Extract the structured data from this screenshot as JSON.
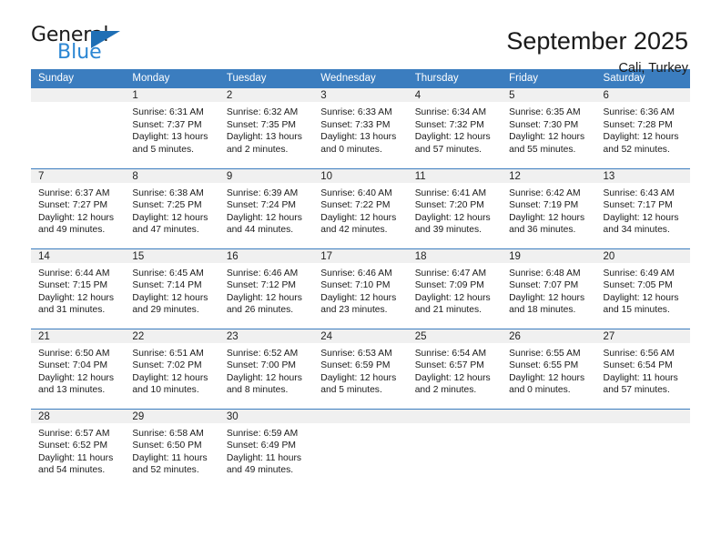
{
  "brand": {
    "name_top": "General",
    "name_bottom": "Blue",
    "triangle_color": "#1f6fb5",
    "blue_color": "#2b86d3"
  },
  "header": {
    "title": "September 2025",
    "subtitle": "Cali, Turkey"
  },
  "theme": {
    "header_row_bg": "#3b7dbf",
    "daynum_band_bg": "#f0f0f0",
    "grid_line": "#3b7dbf",
    "text": "#1a1a1a"
  },
  "weekday_headers": [
    "Sunday",
    "Monday",
    "Tuesday",
    "Wednesday",
    "Thursday",
    "Friday",
    "Saturday"
  ],
  "weeks": [
    [
      {
        "day": "",
        "lines": []
      },
      {
        "day": "1",
        "lines": [
          "Sunrise: 6:31 AM",
          "Sunset: 7:37 PM",
          "Daylight: 13 hours",
          "and 5 minutes."
        ]
      },
      {
        "day": "2",
        "lines": [
          "Sunrise: 6:32 AM",
          "Sunset: 7:35 PM",
          "Daylight: 13 hours",
          "and 2 minutes."
        ]
      },
      {
        "day": "3",
        "lines": [
          "Sunrise: 6:33 AM",
          "Sunset: 7:33 PM",
          "Daylight: 13 hours",
          "and 0 minutes."
        ]
      },
      {
        "day": "4",
        "lines": [
          "Sunrise: 6:34 AM",
          "Sunset: 7:32 PM",
          "Daylight: 12 hours",
          "and 57 minutes."
        ]
      },
      {
        "day": "5",
        "lines": [
          "Sunrise: 6:35 AM",
          "Sunset: 7:30 PM",
          "Daylight: 12 hours",
          "and 55 minutes."
        ]
      },
      {
        "day": "6",
        "lines": [
          "Sunrise: 6:36 AM",
          "Sunset: 7:28 PM",
          "Daylight: 12 hours",
          "and 52 minutes."
        ]
      }
    ],
    [
      {
        "day": "7",
        "lines": [
          "Sunrise: 6:37 AM",
          "Sunset: 7:27 PM",
          "Daylight: 12 hours",
          "and 49 minutes."
        ]
      },
      {
        "day": "8",
        "lines": [
          "Sunrise: 6:38 AM",
          "Sunset: 7:25 PM",
          "Daylight: 12 hours",
          "and 47 minutes."
        ]
      },
      {
        "day": "9",
        "lines": [
          "Sunrise: 6:39 AM",
          "Sunset: 7:24 PM",
          "Daylight: 12 hours",
          "and 44 minutes."
        ]
      },
      {
        "day": "10",
        "lines": [
          "Sunrise: 6:40 AM",
          "Sunset: 7:22 PM",
          "Daylight: 12 hours",
          "and 42 minutes."
        ]
      },
      {
        "day": "11",
        "lines": [
          "Sunrise: 6:41 AM",
          "Sunset: 7:20 PM",
          "Daylight: 12 hours",
          "and 39 minutes."
        ]
      },
      {
        "day": "12",
        "lines": [
          "Sunrise: 6:42 AM",
          "Sunset: 7:19 PM",
          "Daylight: 12 hours",
          "and 36 minutes."
        ]
      },
      {
        "day": "13",
        "lines": [
          "Sunrise: 6:43 AM",
          "Sunset: 7:17 PM",
          "Daylight: 12 hours",
          "and 34 minutes."
        ]
      }
    ],
    [
      {
        "day": "14",
        "lines": [
          "Sunrise: 6:44 AM",
          "Sunset: 7:15 PM",
          "Daylight: 12 hours",
          "and 31 minutes."
        ]
      },
      {
        "day": "15",
        "lines": [
          "Sunrise: 6:45 AM",
          "Sunset: 7:14 PM",
          "Daylight: 12 hours",
          "and 29 minutes."
        ]
      },
      {
        "day": "16",
        "lines": [
          "Sunrise: 6:46 AM",
          "Sunset: 7:12 PM",
          "Daylight: 12 hours",
          "and 26 minutes."
        ]
      },
      {
        "day": "17",
        "lines": [
          "Sunrise: 6:46 AM",
          "Sunset: 7:10 PM",
          "Daylight: 12 hours",
          "and 23 minutes."
        ]
      },
      {
        "day": "18",
        "lines": [
          "Sunrise: 6:47 AM",
          "Sunset: 7:09 PM",
          "Daylight: 12 hours",
          "and 21 minutes."
        ]
      },
      {
        "day": "19",
        "lines": [
          "Sunrise: 6:48 AM",
          "Sunset: 7:07 PM",
          "Daylight: 12 hours",
          "and 18 minutes."
        ]
      },
      {
        "day": "20",
        "lines": [
          "Sunrise: 6:49 AM",
          "Sunset: 7:05 PM",
          "Daylight: 12 hours",
          "and 15 minutes."
        ]
      }
    ],
    [
      {
        "day": "21",
        "lines": [
          "Sunrise: 6:50 AM",
          "Sunset: 7:04 PM",
          "Daylight: 12 hours",
          "and 13 minutes."
        ]
      },
      {
        "day": "22",
        "lines": [
          "Sunrise: 6:51 AM",
          "Sunset: 7:02 PM",
          "Daylight: 12 hours",
          "and 10 minutes."
        ]
      },
      {
        "day": "23",
        "lines": [
          "Sunrise: 6:52 AM",
          "Sunset: 7:00 PM",
          "Daylight: 12 hours",
          "and 8 minutes."
        ]
      },
      {
        "day": "24",
        "lines": [
          "Sunrise: 6:53 AM",
          "Sunset: 6:59 PM",
          "Daylight: 12 hours",
          "and 5 minutes."
        ]
      },
      {
        "day": "25",
        "lines": [
          "Sunrise: 6:54 AM",
          "Sunset: 6:57 PM",
          "Daylight: 12 hours",
          "and 2 minutes."
        ]
      },
      {
        "day": "26",
        "lines": [
          "Sunrise: 6:55 AM",
          "Sunset: 6:55 PM",
          "Daylight: 12 hours",
          "and 0 minutes."
        ]
      },
      {
        "day": "27",
        "lines": [
          "Sunrise: 6:56 AM",
          "Sunset: 6:54 PM",
          "Daylight: 11 hours",
          "and 57 minutes."
        ]
      }
    ],
    [
      {
        "day": "28",
        "lines": [
          "Sunrise: 6:57 AM",
          "Sunset: 6:52 PM",
          "Daylight: 11 hours",
          "and 54 minutes."
        ]
      },
      {
        "day": "29",
        "lines": [
          "Sunrise: 6:58 AM",
          "Sunset: 6:50 PM",
          "Daylight: 11 hours",
          "and 52 minutes."
        ]
      },
      {
        "day": "30",
        "lines": [
          "Sunrise: 6:59 AM",
          "Sunset: 6:49 PM",
          "Daylight: 11 hours",
          "and 49 minutes."
        ]
      },
      {
        "day": "",
        "lines": []
      },
      {
        "day": "",
        "lines": []
      },
      {
        "day": "",
        "lines": []
      },
      {
        "day": "",
        "lines": []
      }
    ]
  ]
}
